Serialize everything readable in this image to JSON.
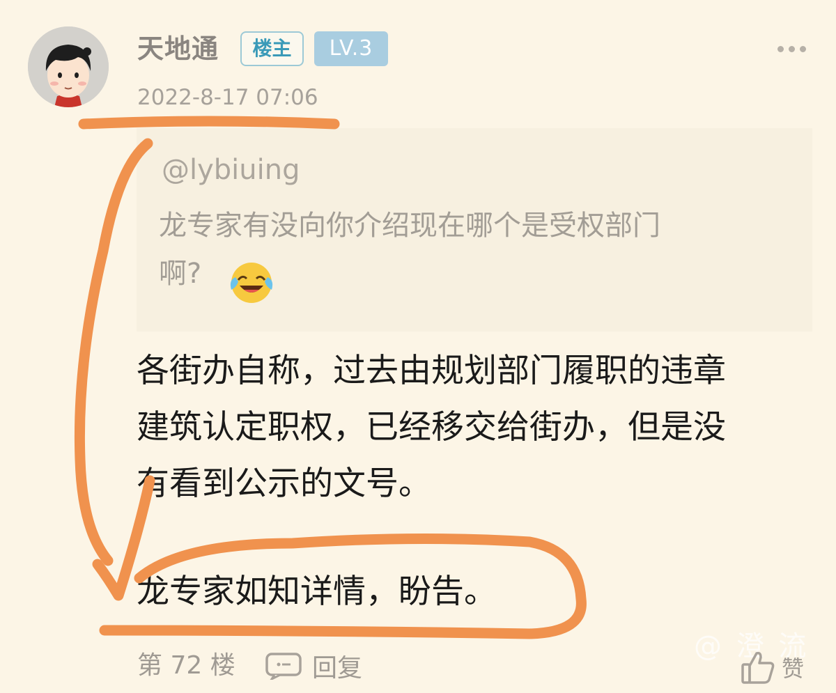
{
  "post": {
    "username": "天地通",
    "op_badge": "楼主",
    "level_badge": "LV.3",
    "timestamp": "2022-8-17 07:06",
    "quote": {
      "user": "@lybiuing",
      "text_line1": "龙专家有没向你介绍现在哪个是受权部门",
      "text_line2": "啊?"
    },
    "content": {
      "line1": "各街办自称，过去由规划部门履职的违章",
      "line2": "建筑认定职权，已经移交给街办，但是没",
      "line3": "有看到公示的文号。",
      "line4": "龙专家如知详情，盼告。"
    },
    "footer": {
      "floor": "第 72 楼",
      "reply_label": "回复",
      "like_label": "赞"
    },
    "watermark": "@ 澄 流"
  },
  "colors": {
    "background": "#fcf5e6",
    "annotation_stroke": "#f0924e",
    "op_badge_text": "#3a9ab8",
    "level_badge_bg": "#a9cde0"
  },
  "icons": {
    "more": "more-dots-icon",
    "reply": "comment-bubble-icon",
    "like": "thumbs-up-icon",
    "emoji": "crying-laughing-emoji"
  }
}
